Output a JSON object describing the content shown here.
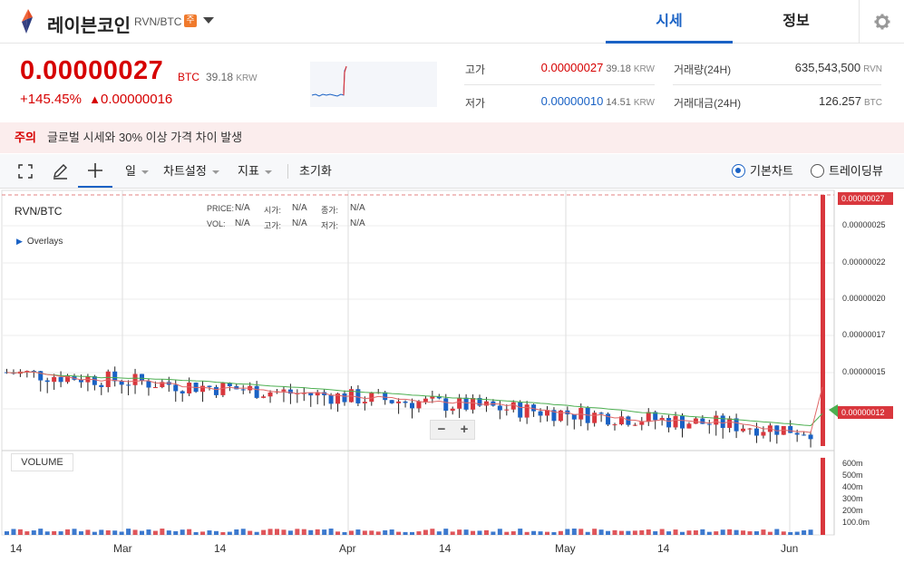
{
  "header": {
    "coin_name": "레이븐코인",
    "pair": "RVN/BTC",
    "warning_badge": "주",
    "tabs": [
      {
        "label": "시세",
        "active": true
      },
      {
        "label": "정보",
        "active": false
      }
    ]
  },
  "price": {
    "current": "0.00000027",
    "unit": "BTC",
    "krw_value": "39.18",
    "krw_unit": "KRW",
    "change_percent": "+145.45%",
    "change_arrow": "▲",
    "change_amount": "0.00000016"
  },
  "stats": {
    "high_label": "고가",
    "high_value": "0.00000027",
    "high_krw": "39.18",
    "low_label": "저가",
    "low_value": "0.00000010",
    "low_krw": "14.51",
    "krw_unit": "KRW",
    "volume_label": "거래량(24H)",
    "volume_value": "635,543,500",
    "volume_unit": "RVN",
    "amount_label": "거래대금(24H)",
    "amount_value": "126.257",
    "amount_unit": "BTC"
  },
  "notice": {
    "label": "주의",
    "text": "글로벌 시세와 30% 이상 가격 차이 발생"
  },
  "toolbar": {
    "period": "일",
    "chart_settings": "차트설정",
    "indicators": "지표",
    "reset": "초기화",
    "chart_types": [
      {
        "label": "기본차트",
        "selected": true
      },
      {
        "label": "트레이딩뷰",
        "selected": false
      }
    ]
  },
  "chart": {
    "symbol": "RVN/BTC",
    "overlays": "Overlays",
    "ohlc_labels": {
      "price": "PRICE:",
      "vol": "VOL:",
      "open": "시가:",
      "high": "고가:",
      "close": "종가:",
      "low": "저가:"
    },
    "ohlc_value": "N/A",
    "volume_label": "VOLUME",
    "zoom_out": "−",
    "zoom_in": "+",
    "current_tag": "0.00000027",
    "ma_tag": "0.00000012",
    "y_ticks": [
      "0.00000025",
      "0.00000022",
      "0.00000020",
      "0.00000017",
      "0.00000015"
    ],
    "volume_ticks": [
      "600m",
      "500m",
      "400m",
      "300m",
      "200m",
      "100.0m"
    ],
    "x_ticks": [
      "14",
      "Mar",
      "14",
      "Apr",
      "14",
      "May",
      "14",
      "Jun"
    ]
  },
  "chart_data": {
    "type": "bar",
    "pair": "RVN/BTC",
    "price_unit": "BTC",
    "ylim": [
      1e-07,
      2.7e-07
    ],
    "current_price": 2.7e-07,
    "colors": {
      "up": "#d9373d",
      "down": "#1a62c5",
      "ma_short": "#e06666",
      "ma_long": "#4caf50"
    },
    "volume_unit": "m",
    "last_volume": 635.5435
  }
}
